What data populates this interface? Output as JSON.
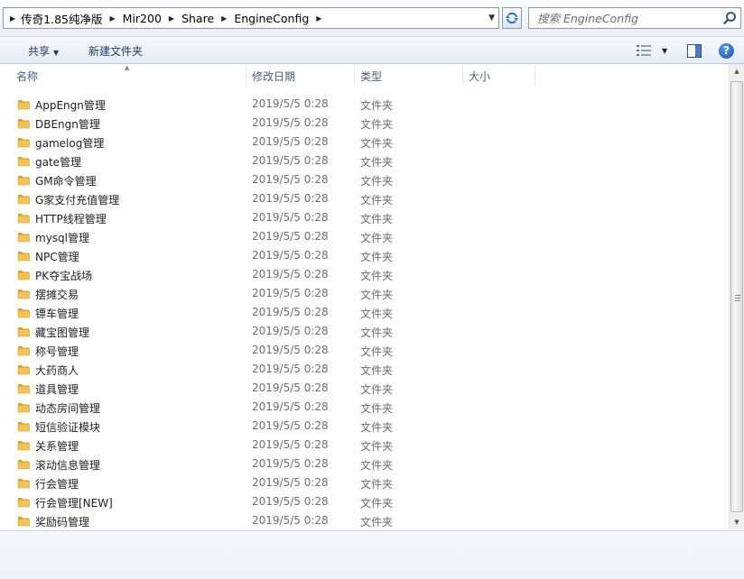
{
  "address": {
    "crumbs": [
      "传奇1.85纯净版",
      "Mir200",
      "Share",
      "EngineConfig"
    ]
  },
  "search": {
    "placeholder": "搜索 EngineConfig"
  },
  "toolbar": {
    "share_label": "共享",
    "new_folder_label": "新建文件夹"
  },
  "columns": {
    "name": "名称",
    "date": "修改日期",
    "type": "类型",
    "size": "大小"
  },
  "files": [
    {
      "name": "AppEngn管理",
      "date": "2019/5/5 0:28",
      "type": "文件夹"
    },
    {
      "name": "DBEngn管理",
      "date": "2019/5/5 0:28",
      "type": "文件夹"
    },
    {
      "name": "gamelog管理",
      "date": "2019/5/5 0:28",
      "type": "文件夹"
    },
    {
      "name": "gate管理",
      "date": "2019/5/5 0:28",
      "type": "文件夹"
    },
    {
      "name": "GM命令管理",
      "date": "2019/5/5 0:28",
      "type": "文件夹"
    },
    {
      "name": "G家支付充值管理",
      "date": "2019/5/5 0:28",
      "type": "文件夹"
    },
    {
      "name": "HTTP线程管理",
      "date": "2019/5/5 0:28",
      "type": "文件夹"
    },
    {
      "name": "mysql管理",
      "date": "2019/5/5 0:28",
      "type": "文件夹"
    },
    {
      "name": "NPC管理",
      "date": "2019/5/5 0:28",
      "type": "文件夹"
    },
    {
      "name": "PK夺宝战场",
      "date": "2019/5/5 0:28",
      "type": "文件夹"
    },
    {
      "name": "摆摊交易",
      "date": "2019/5/5 0:28",
      "type": "文件夹"
    },
    {
      "name": "镖车管理",
      "date": "2019/5/5 0:28",
      "type": "文件夹"
    },
    {
      "name": "藏宝图管理",
      "date": "2019/5/5 0:28",
      "type": "文件夹"
    },
    {
      "name": "称号管理",
      "date": "2019/5/5 0:28",
      "type": "文件夹"
    },
    {
      "name": "大药商人",
      "date": "2019/5/5 0:28",
      "type": "文件夹"
    },
    {
      "name": "道具管理",
      "date": "2019/5/5 0:28",
      "type": "文件夹"
    },
    {
      "name": "动态房间管理",
      "date": "2019/5/5 0:28",
      "type": "文件夹"
    },
    {
      "name": "短信验证模块",
      "date": "2019/5/5 0:28",
      "type": "文件夹"
    },
    {
      "name": "关系管理",
      "date": "2019/5/5 0:28",
      "type": "文件夹"
    },
    {
      "name": "滚动信息管理",
      "date": "2019/5/5 0:28",
      "type": "文件夹"
    },
    {
      "name": "行会管理",
      "date": "2019/5/5 0:28",
      "type": "文件夹"
    },
    {
      "name": "行会管理[NEW]",
      "date": "2019/5/5 0:28",
      "type": "文件夹"
    },
    {
      "name": "奖励码管理",
      "date": "2019/5/5 0:28",
      "type": "文件夹"
    }
  ],
  "colors": {
    "folder": "#f2c35a",
    "folder_dark": "#d9a133",
    "accent": "#1e395b"
  }
}
